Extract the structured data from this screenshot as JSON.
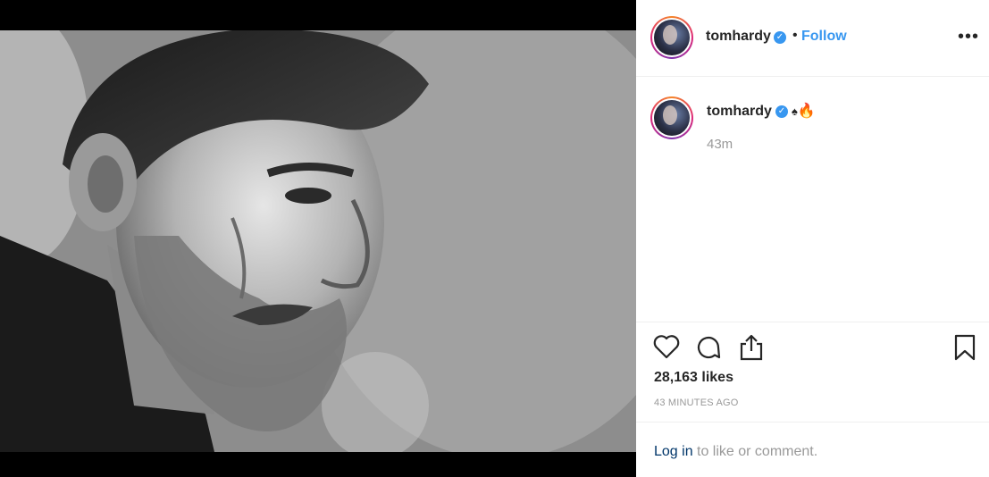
{
  "post": {
    "username": "tomhardy",
    "verified": true,
    "separator": "•",
    "follow_label": "Follow",
    "more_label": "•••",
    "caption": {
      "username": "tomhardy",
      "spade": "♠",
      "fire": "🔥",
      "time": "43m"
    },
    "likes": "28,163 likes",
    "timestamp": "43 MINUTES AGO",
    "login_link": "Log in",
    "login_rest": "to like or comment."
  },
  "icons": {
    "like": "heart-icon",
    "comment": "comment-icon",
    "share": "share-icon",
    "save": "bookmark-icon",
    "verified": "verified-badge-icon"
  },
  "colors": {
    "accent": "#3897f0",
    "text": "#262626",
    "muted": "#999999",
    "link": "#003569"
  }
}
